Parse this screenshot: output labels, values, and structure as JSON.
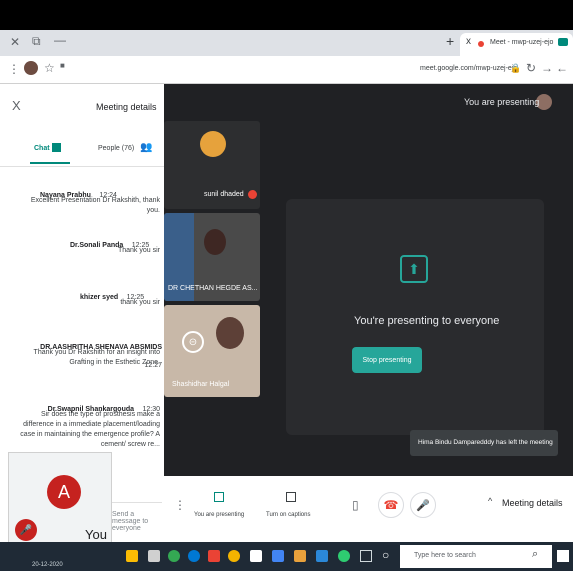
{
  "browser": {
    "tab_title": "Meet - mwp-uzej-ejo",
    "url": "meet.google.com/mwp-uzej-ejo",
    "new_tab_icon": "+",
    "close_tab_icon": "x"
  },
  "meeting": {
    "presenting_banner": "You are presenting",
    "presenting_card_title": "You're presenting to everyone",
    "stop_presenting_label": "Stop presenting",
    "notification": "Hima Bindu Damparedddy has left the meeting"
  },
  "participants": [
    {
      "name": "sunil dhaded"
    },
    {
      "name": "DR CHETHAN HEGDE AS..."
    },
    {
      "name": "Shashidhar Halgal"
    }
  ],
  "sidebar": {
    "title": "Meeting details",
    "close_icon": "X",
    "tab_people": "People (76)",
    "tab_chat": "Chat",
    "message_placeholder": "Send a message to everyone",
    "messages": [
      {
        "sender": "Nayana Prabhu",
        "time": "12:24",
        "text": "Excellent Presentation Dr Rakshith, thank you."
      },
      {
        "sender": "Dr.Sonali Panda",
        "time": "12:25",
        "text": "Thank you sir"
      },
      {
        "sender": "khizer syed",
        "time": "12:25",
        "text": "thank you sir"
      },
      {
        "sender": "DR.AASHRITHA SHENAVA ABSMIDS",
        "time": "12:27",
        "text": "Thank you Dr Rakshith for an insight into Grafting in the Esthetic Zone."
      },
      {
        "sender": "Dr.Swapnil Shankargouda",
        "time": "12:30",
        "text": "Sir does the type of prosthesis make a difference in a immediate placement/loading case in maintaining the emergence profile? A cement/ screw re..."
      }
    ]
  },
  "self_tile": {
    "avatar_letter": "A",
    "name": "You"
  },
  "controls": {
    "meeting_details": "Meeting details",
    "turn_on_captions": "Turn on captions",
    "you_are_presenting": "You are presenting"
  },
  "taskbar": {
    "search_placeholder": "Type here to search",
    "date": "20-12-2020"
  },
  "colors": {
    "accent": "#00897b",
    "end_call": "#ea4335",
    "avatar_bg": "#c5221f",
    "meet_bg": "#202124"
  }
}
